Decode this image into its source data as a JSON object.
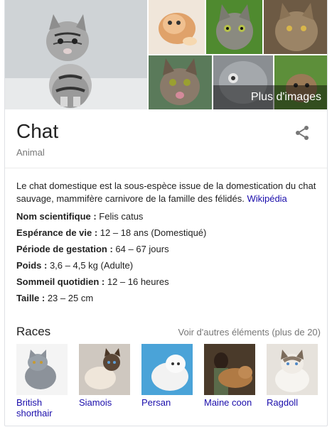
{
  "gallery": {
    "more_images_label": "Plus d'images",
    "colors": {
      "overlay": "#000000"
    }
  },
  "entity": {
    "title": "Chat",
    "subtitle": "Animal",
    "share_icon": "share-icon"
  },
  "description": {
    "text": "Le chat domestique est la sous-espèce issue de la domestication du chat sauvage, mammifère carnivore de la famille des félidés.",
    "source_link": "Wikipédia"
  },
  "facts": [
    {
      "label": "Nom scientifique :",
      "value": " Felis catus"
    },
    {
      "label": "Espérance de vie :",
      "value": " 12 – 18 ans (Domestiqué)"
    },
    {
      "label": "Période de gestation :",
      "value": " 64 – 67 jours"
    },
    {
      "label": "Poids :",
      "value": " 3,6 – 4,5 kg (Adulte)"
    },
    {
      "label": "Sommeil quotidien :",
      "value": " 12 – 16 heures"
    },
    {
      "label": "Taille :",
      "value": " 23 – 25 cm"
    }
  ],
  "races": {
    "title": "Races",
    "more_link": "Voir d'autres éléments (plus de 20)",
    "items": [
      {
        "label": "British shorthair"
      },
      {
        "label": "Siamois"
      },
      {
        "label": "Persan"
      },
      {
        "label": "Maine coon"
      },
      {
        "label": "Ragdoll"
      }
    ]
  },
  "colors": {
    "link": "#1a0dab",
    "muted": "#777777",
    "text": "#222222",
    "border": "#dfe1e5"
  }
}
